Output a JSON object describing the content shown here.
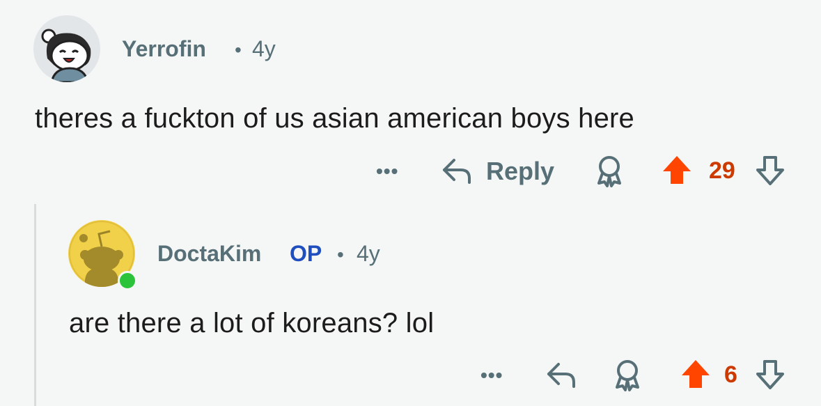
{
  "comments": [
    {
      "username": "Yerrofin",
      "separator": "•",
      "age": "4y",
      "text": "theres a fuckton of us asian american boys here",
      "more_label": "•••",
      "reply_label": "Reply",
      "score": "29",
      "avatar": "snoo-avatar-with-bun-hair"
    },
    {
      "username": "DoctaKim",
      "op_badge": "OP",
      "separator": "•",
      "age": "4y",
      "text": "are there a lot of koreans? lol",
      "more_label": "•••",
      "score": "6",
      "avatar": "default-snoo-yellow",
      "online": true
    }
  ],
  "colors": {
    "background": "#f5f6f6",
    "username": "#576f76",
    "op": "#1f4fbf",
    "upvote": "#ff4500",
    "score": "#cc3a00",
    "online": "#2bc33a"
  }
}
